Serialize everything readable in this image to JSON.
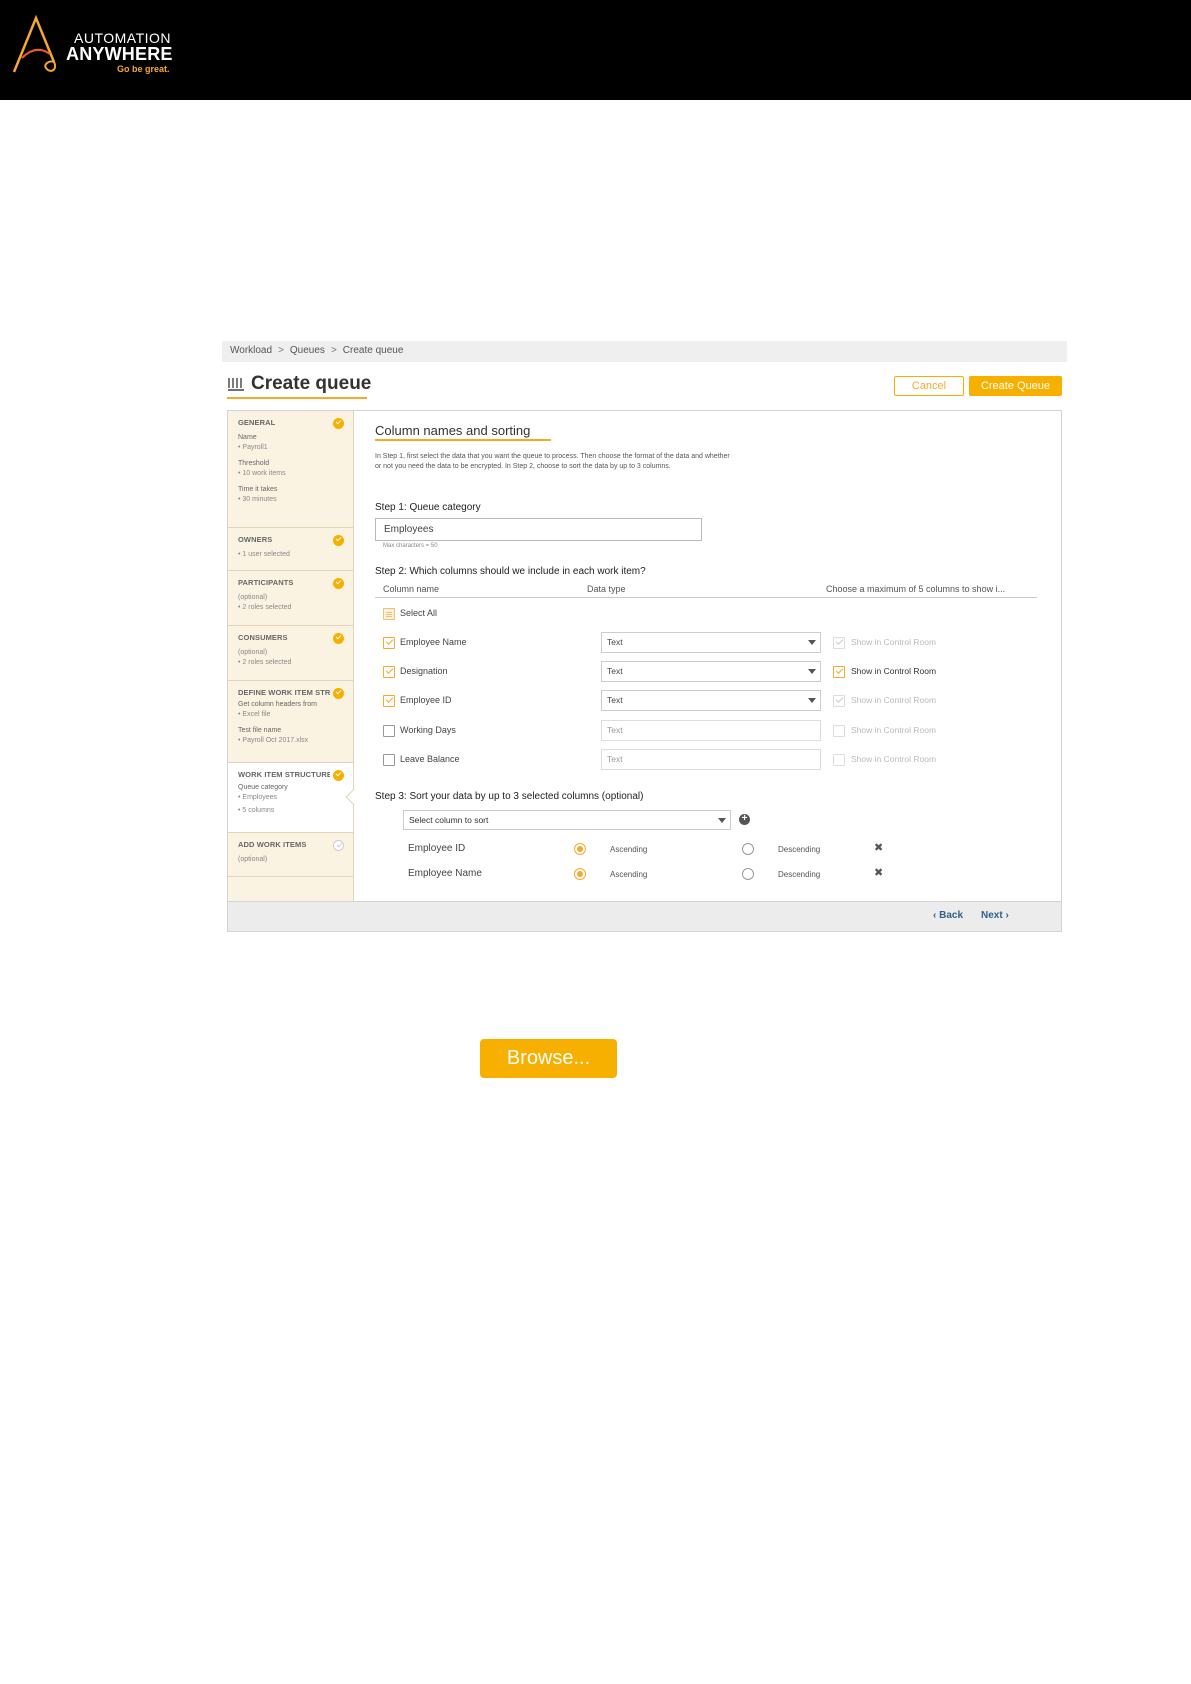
{
  "brand": {
    "line1": "AUTOMATION",
    "line2": "ANYWHERE",
    "tagline": "Go be great.",
    "accent_color": "#f7a92b"
  },
  "breadcrumb": [
    "Workload",
    "Queues",
    "Create queue"
  ],
  "breadcrumb_sep": ">",
  "page": {
    "title": "Create queue",
    "title_icon": "queue-icon",
    "cancel_label": "Cancel",
    "create_label": "Create Queue"
  },
  "sidebar": {
    "general": {
      "head": "GENERAL",
      "lines": [
        [
          "Name",
          "• Payroll1"
        ],
        [
          "Threshold",
          "• 10 work items"
        ],
        [
          "Time it takes",
          "• 30 minutes"
        ]
      ]
    },
    "owners": {
      "head": "OWNERS",
      "lines": [
        "• 1 user selected"
      ]
    },
    "participants": {
      "head": "PARTICIPANTS",
      "lines": [
        "(optional)",
        "• 2 roles selected"
      ]
    },
    "consumers": {
      "head": "CONSUMERS",
      "lines": [
        "(optional)",
        "• 2 roles selected"
      ]
    },
    "define": {
      "head": "DEFINE WORK ITEM STR...",
      "lines": [
        [
          "Get column headers from",
          "• Excel file"
        ],
        [
          "Test file name",
          "• Payroll Oct 2017.xlsx"
        ]
      ]
    },
    "structure": {
      "head": "WORK ITEM STRUCTURE",
      "lines": [
        "Queue category",
        "• Employees",
        "• 5 columns"
      ]
    },
    "add": {
      "head": "ADD WORK ITEMS",
      "lines": [
        "(optional)"
      ]
    }
  },
  "content": {
    "section_title": "Column names and sorting",
    "intro": "In Step 1, first select the data that you want the queue to process. Then choose the format of the data and whether or not you need the data to be encrypted. In Step 2, choose to sort the data by up to 3 columns.",
    "step1": "Step 1: Queue category",
    "category_value": "Employees",
    "category_hint": "Max characters = 50",
    "step2": "Step 2: Which columns should we include in each work item?",
    "col_name_hdr": "Column name",
    "data_type_hdr": "Data type",
    "show_hdr": "Choose a maximum of 5 columns to show i...",
    "select_all": "Select All",
    "show_label": "Show in Control Room",
    "columns": [
      {
        "name": "Employee Name",
        "type": "Text"
      },
      {
        "name": "Designation",
        "type": "Text"
      },
      {
        "name": "Employee ID",
        "type": "Text"
      },
      {
        "name": "Working Days",
        "type": "Text"
      },
      {
        "name": "Leave Balance",
        "type": "Text"
      }
    ],
    "step3": "Step 3: Sort your data by up to 3 selected columns (optional)",
    "sort_placeholder": "Select column to sort",
    "sort_rows": [
      {
        "name": "Employee ID",
        "asc": "Ascending",
        "desc": "Descending"
      },
      {
        "name": "Employee Name",
        "asc": "Ascending",
        "desc": "Descending"
      }
    ]
  },
  "footer": {
    "back": "Back",
    "next": "Next"
  },
  "browse_label": "Browse..."
}
